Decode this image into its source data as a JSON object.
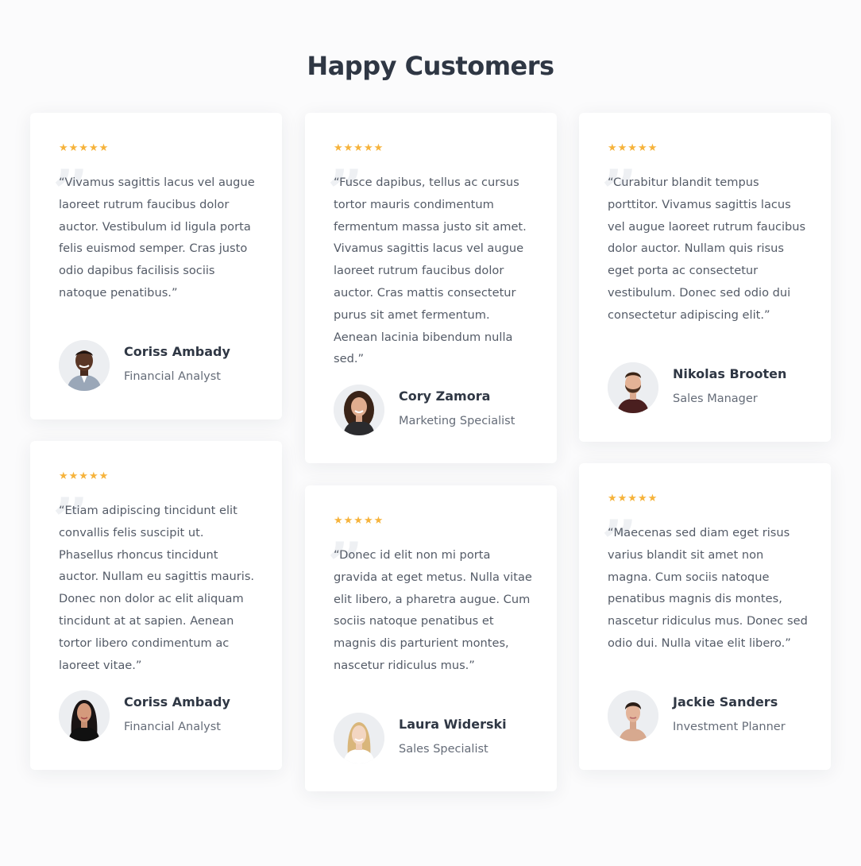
{
  "section": {
    "title": "Happy Customers"
  },
  "accent": {
    "star_color": "#f6b33b"
  },
  "testimonials": [
    {
      "stars": "★★★★★",
      "rating": 5,
      "quote": "“Vivamus sagittis lacus vel augue laoreet rutrum faucibus dolor auctor. Vestibulum id ligula porta felis euismod semper. Cras justo odio dapibus facilisis sociis natoque penatibus.”",
      "name": "Coriss Ambady",
      "role": "Financial Analyst",
      "avatar": "avatar-man-smiling"
    },
    {
      "stars": "★★★★★",
      "rating": 5,
      "quote": "“Fusce dapibus, tellus ac cursus tortor mauris condimentum fermentum massa justo sit amet. Vivamus sagittis lacus vel augue laoreet rutrum faucibus dolor auctor. Cras mattis consectetur purus sit amet fermentum. Aenean lacinia bibendum nulla sed.”",
      "name": "Cory Zamora",
      "role": "Marketing Specialist",
      "avatar": "avatar-woman-curly-hair"
    },
    {
      "stars": "★★★★★",
      "rating": 5,
      "quote": "“Curabitur blandit tempus porttitor. Vivamus sagittis lacus vel augue laoreet rutrum faucibus dolor auctor. Nullam quis risus eget porta ac consectetur vestibulum. Donec sed odio dui consectetur adipiscing elit.”",
      "name": "Nikolas Brooten",
      "role": "Sales Manager",
      "avatar": "avatar-man-beard"
    },
    {
      "stars": "★★★★★",
      "rating": 5,
      "quote": "“Etiam adipiscing tincidunt elit convallis felis suscipit ut. Phasellus rhoncus tincidunt auctor. Nullam eu sagittis mauris. Donec non dolor ac elit aliquam tincidunt at at sapien. Aenean tortor libero condimentum ac laoreet vitae.”",
      "name": "Coriss Ambady",
      "role": "Financial Analyst",
      "avatar": "avatar-woman-dark-hair"
    },
    {
      "stars": "★★★★★",
      "rating": 5,
      "quote": "“Donec id elit non mi porta gravida at eget metus. Nulla vitae elit libero, a pharetra augue. Cum sociis natoque penatibus et magnis dis parturient montes, nascetur ridiculus mus.”",
      "name": "Laura Widerski",
      "role": "Sales Specialist",
      "avatar": "avatar-woman-blonde"
    },
    {
      "stars": "★★★★★",
      "rating": 5,
      "quote": "“Maecenas sed diam eget risus varius blandit sit amet non magna. Cum sociis natoque penatibus magnis dis montes, nascetur ridiculus mus. Donec sed odio dui. Nulla vitae elit libero.”",
      "name": "Jackie Sanders",
      "role": "Investment Planner",
      "avatar": "avatar-woman-hair-bun"
    }
  ]
}
